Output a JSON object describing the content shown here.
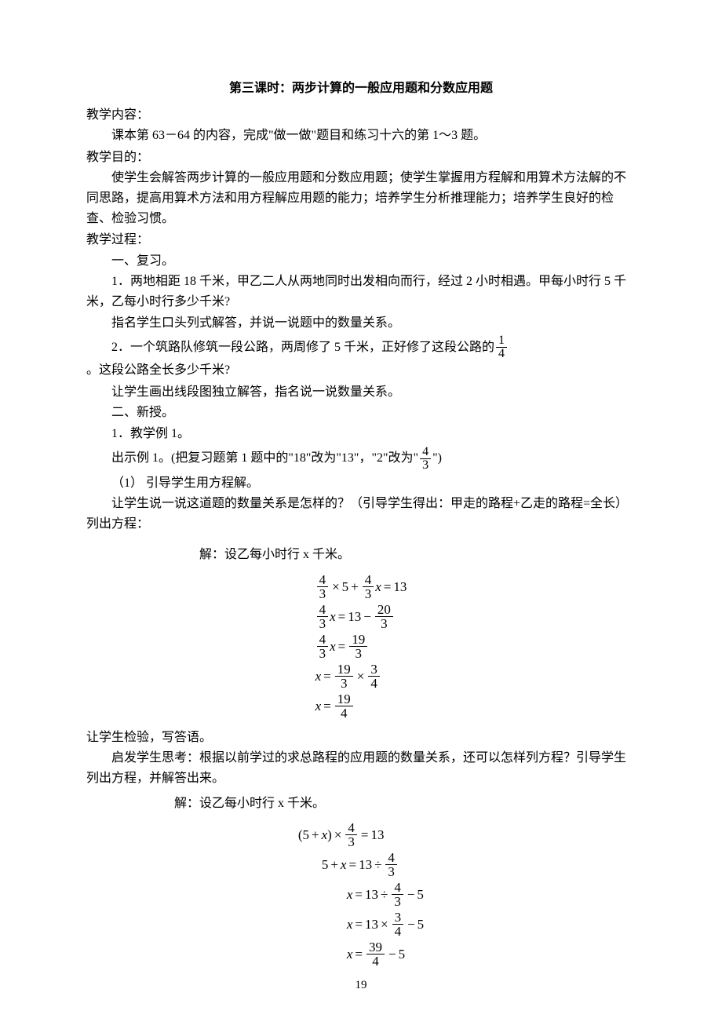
{
  "title": "第三课时：两步计算的一般应用题和分数应用题",
  "h_content": "教学内容：",
  "content_line": "课本第 63－64 的内容，完成\"做一做\"题目和练习十六的第 1～3 题。",
  "h_purpose": "教学目的：",
  "purpose_text": "使学生会解答两步计算的一般应用题和分数应用题；使学生掌握用方程解和用算术方法解的不同思路，提高用算术方法和用方程解应用题的能力；培养学生分析推理能力；培养学生良好的检查、检验习惯。",
  "h_process": "教学过程：",
  "s1": "一、复习。",
  "q1": "1．两地相距 18 千米，甲乙二人从两地同时出发相向而行，经过 2 小时相遇。甲每小时行 5 千米，乙每小时行多少千米?",
  "q1_note": "指名学生口头列式解答，并说一说题中的数量关系。",
  "q2_pre": "2．一个筑路队修筑一段公路，两周修了 5 千米，正好修了这段公路的",
  "q2_post": "。这段公路全长多少千米?",
  "q2_note": "让学生画出线段图独立解答，指名说一说数量关系。",
  "s2": "二、新授。",
  "s2_1": "1．教学例 1。",
  "ex1_pre": "出示例 1。(把复习题第 1 题中的\"18\"改为\"13\"，\"2\"改为\"",
  "ex1_post": "\")",
  "step1": "（1） 引导学生用方程解。",
  "step1_text": "让学生说一说这道题的数量关系是怎样的？（引导学生得出：甲走的路程+乙走的路程=全长）列出方程：",
  "solve1": "解：设乙每小时行  x 千米。",
  "check_text": "让学生检验，写答语。",
  "think_text": "启发学生思考：根据以前学过的求总路程的应用题的数量关系，还可以怎样列方程？引导学生列出方程，并解答出来。",
  "solve2": "解：设乙每小时行 x  千米。",
  "frac_1_4": {
    "n": "1",
    "d": "4"
  },
  "frac_4_3": {
    "n": "4",
    "d": "3"
  },
  "frac_20_3": {
    "n": "20",
    "d": "3"
  },
  "frac_19_3": {
    "n": "19",
    "d": "3"
  },
  "frac_3_4": {
    "n": "3",
    "d": "4"
  },
  "frac_19_4": {
    "n": "19",
    "d": "4"
  },
  "frac_39_4": {
    "n": "39",
    "d": "4"
  },
  "n5": "5",
  "n13": "13",
  "page_number": "19"
}
